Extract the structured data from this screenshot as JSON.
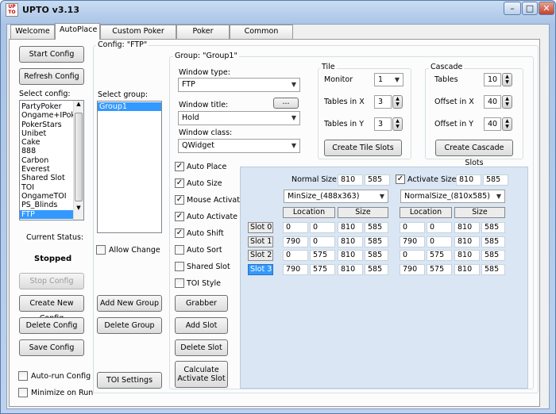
{
  "window": {
    "app_icon_text": "UP TO",
    "title": "UPTO  v3.13"
  },
  "tabs": [
    "Welcome",
    "AutoPlace",
    "Custom Poker Room",
    "Poker Room",
    "Common Settings"
  ],
  "left": {
    "start_config": "Start Config",
    "refresh_config": "Refresh Config",
    "select_config_label": "Select config:",
    "configs": [
      "PartyPoker",
      "Ongame+IPoke",
      "PokerStars",
      "Unibet",
      "Cake",
      "888",
      "Carbon",
      "Everest",
      "Shared Slot",
      "TOI",
      "OngameTOI",
      "PS_Blinds",
      "FTP"
    ],
    "selected_config": "FTP",
    "current_status_label": "Current Status:",
    "status_value": "Stopped",
    "stop_config": "Stop Config",
    "create_new_config": "Create New Config",
    "delete_config": "Delete Config",
    "save_config": "Save Config",
    "auto_run": "Auto-run Config",
    "minimize_on_run": "Minimize on Run"
  },
  "config": {
    "group_label": "Config: \"FTP\"",
    "select_group_label": "Select group:",
    "groups": [
      "Group1"
    ],
    "allow_change": "Allow Change",
    "add_new_group": "Add New Group",
    "delete_group": "Delete Group",
    "toi_settings": "TOI Settings"
  },
  "group": {
    "label": "Group: \"Group1\"",
    "window_type_label": "Window type:",
    "window_type_value": "FTP",
    "window_title_label": "Window title:",
    "window_title_btn": "...",
    "window_title_value": "Hold",
    "window_class_label": "Window class:",
    "window_class_value": "QWidget",
    "checks": [
      {
        "label": "Auto Place",
        "checked": true
      },
      {
        "label": "Auto Size",
        "checked": true
      },
      {
        "label": "Mouse Activate",
        "checked": true
      },
      {
        "label": "Auto Activate",
        "checked": true
      },
      {
        "label": "Auto Shift",
        "checked": true
      },
      {
        "label": "Auto Sort",
        "checked": false
      },
      {
        "label": "Shared Slot",
        "checked": false
      },
      {
        "label": "TOI Style",
        "checked": false
      }
    ],
    "grabber": "Grabber",
    "add_slot": "Add Slot",
    "delete_slot": "Delete Slot",
    "calculate_line1": "Calculate",
    "calculate_line2": "Activate Slot",
    "check_mark": "✓"
  },
  "tile": {
    "label": "Tile",
    "monitor_label": "Monitor",
    "monitor_value": "1",
    "tables_x_label": "Tables in X",
    "tables_x_value": "3",
    "tables_y_label": "Tables in Y",
    "tables_y_value": "3",
    "create_btn": "Create Tile Slots"
  },
  "cascade": {
    "label": "Cascade",
    "tables_label": "Tables",
    "tables_value": "10",
    "offset_x_label": "Offset in X",
    "offset_x_value": "40",
    "offset_y_label": "Offset in Y",
    "offset_y_value": "40",
    "create_btn": "Create Cascade Slots"
  },
  "slots": {
    "normal_size_label": "Normal Size",
    "normal_w": "810",
    "normal_h": "585",
    "activate_size_label": "Activate Size",
    "activate_w": "810",
    "activate_h": "585",
    "min_size_combo": "MinSize_(488x363)",
    "normal_size_combo": "NormalSize_(810x585)",
    "location_hdr": "Location",
    "size_hdr": "Size",
    "rows": [
      {
        "name": "Slot 0",
        "lx": "0",
        "ly": "0",
        "sw": "810",
        "sh": "585",
        "alx": "0",
        "aly": "0",
        "asw": "810",
        "ash": "585"
      },
      {
        "name": "Slot 1",
        "lx": "790",
        "ly": "0",
        "sw": "810",
        "sh": "585",
        "alx": "790",
        "aly": "0",
        "asw": "810",
        "ash": "585"
      },
      {
        "name": "Slot 2",
        "lx": "0",
        "ly": "575",
        "sw": "810",
        "sh": "585",
        "alx": "0",
        "aly": "575",
        "asw": "810",
        "ash": "585"
      },
      {
        "name": "Slot 3",
        "lx": "790",
        "ly": "575",
        "sw": "810",
        "sh": "585",
        "alx": "790",
        "aly": "575",
        "asw": "810",
        "ash": "585"
      }
    ],
    "selected_slot": "Slot 3"
  }
}
